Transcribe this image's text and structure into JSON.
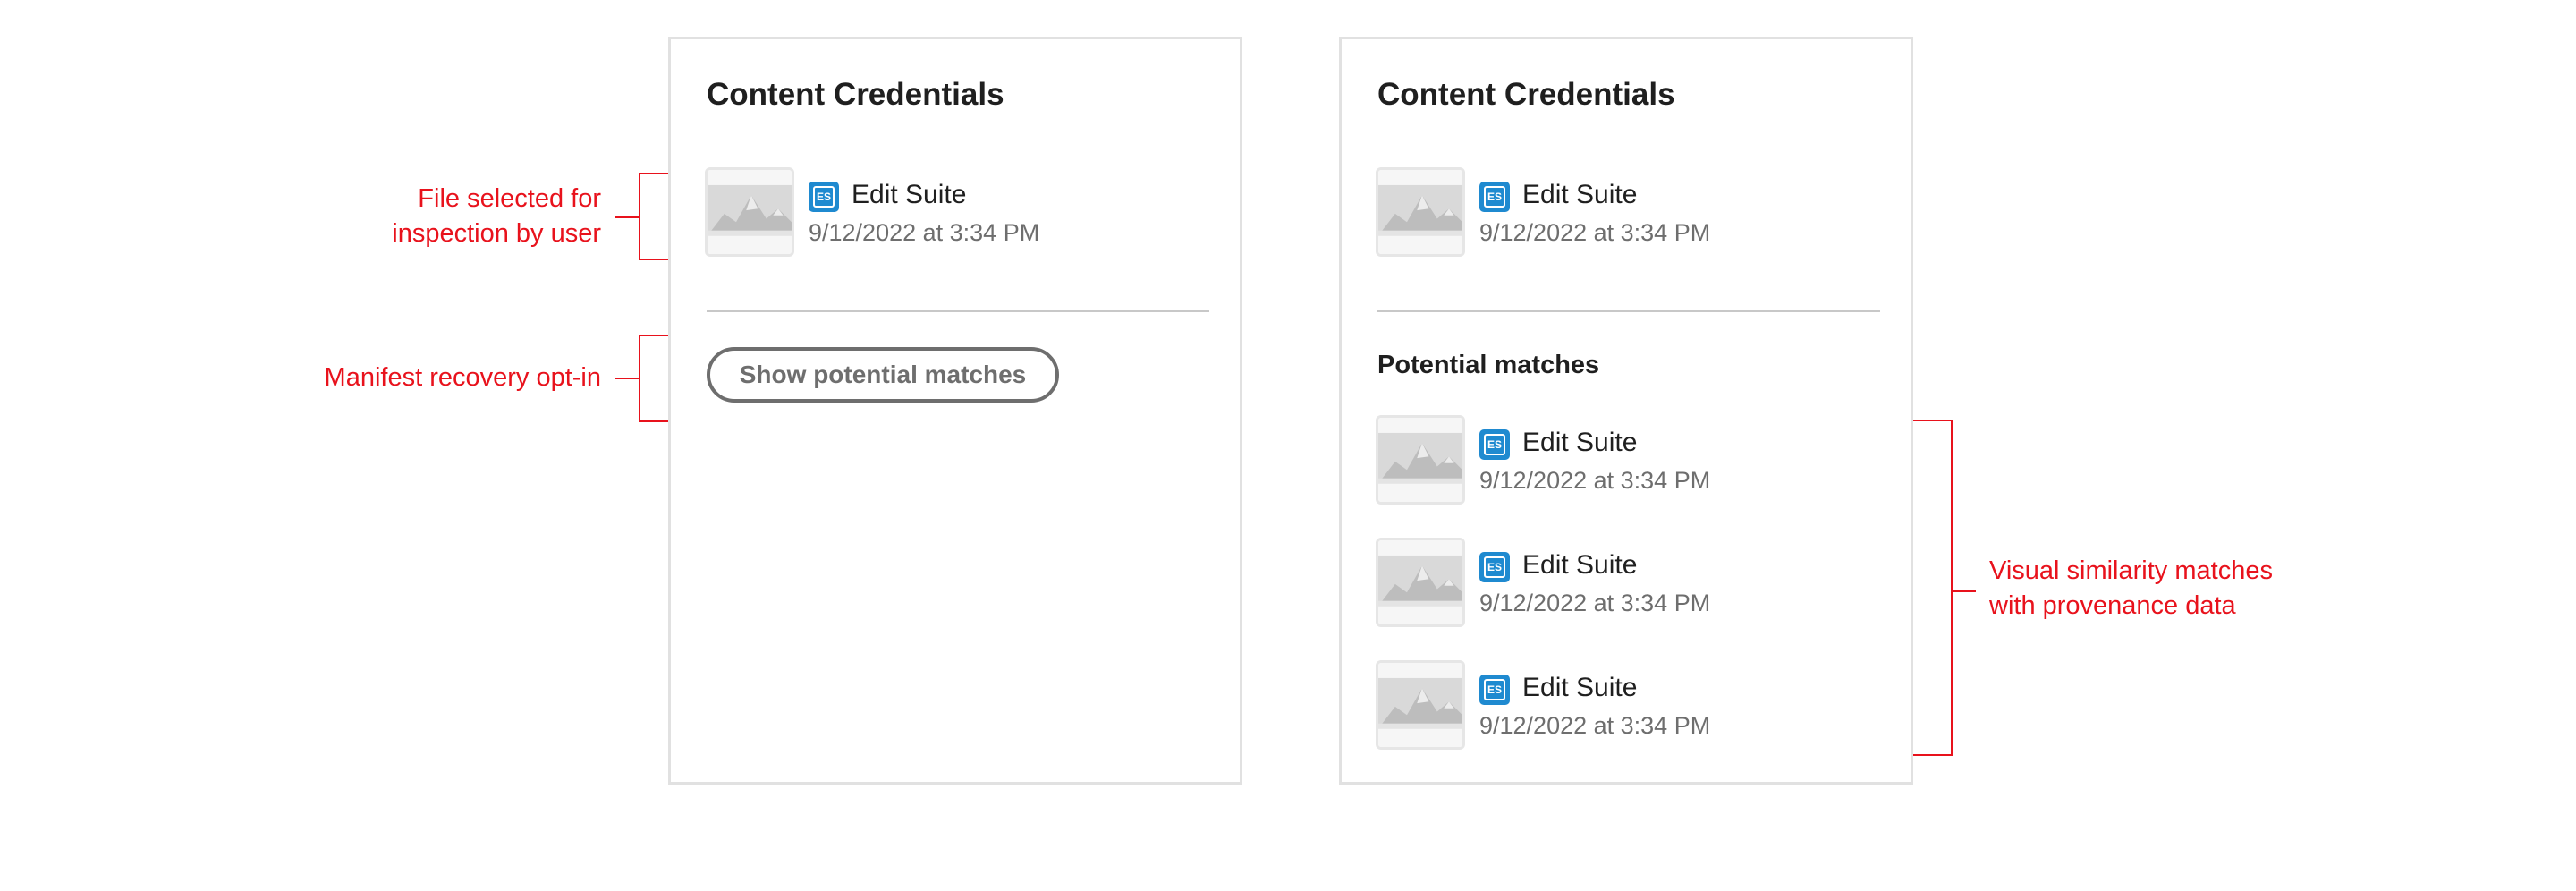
{
  "annotations": {
    "file_selected": [
      "File selected for",
      "inspection by user"
    ],
    "manifest_recovery": "Manifest recovery opt-in",
    "visual_similarity": [
      "Visual similarity matches",
      "with provenance data"
    ]
  },
  "colors": {
    "annotation": "#e8121c",
    "app_icon": "#1f8ad0",
    "panel_border": "#e1e1e1",
    "muted_text": "#6e6e6e"
  },
  "left_panel": {
    "title": "Content Credentials",
    "selected_file": {
      "app_icon_text": "ES",
      "app_icon": "edit-suite-app-icon",
      "app_name": "Edit Suite",
      "date": "9/12/2022 at 3:34 PM"
    },
    "show_matches_button": "Show potential matches"
  },
  "right_panel": {
    "title": "Content Credentials",
    "selected_file": {
      "app_icon_text": "ES",
      "app_icon": "edit-suite-app-icon",
      "app_name": "Edit Suite",
      "date": "9/12/2022 at 3:34 PM"
    },
    "matches_heading": "Potential matches",
    "matches": [
      {
        "app_icon_text": "ES",
        "app_name": "Edit Suite",
        "date": "9/12/2022 at 3:34 PM"
      },
      {
        "app_icon_text": "ES",
        "app_name": "Edit Suite",
        "date": "9/12/2022 at 3:34 PM"
      },
      {
        "app_icon_text": "ES",
        "app_name": "Edit Suite",
        "date": "9/12/2022 at 3:34 PM"
      }
    ]
  }
}
